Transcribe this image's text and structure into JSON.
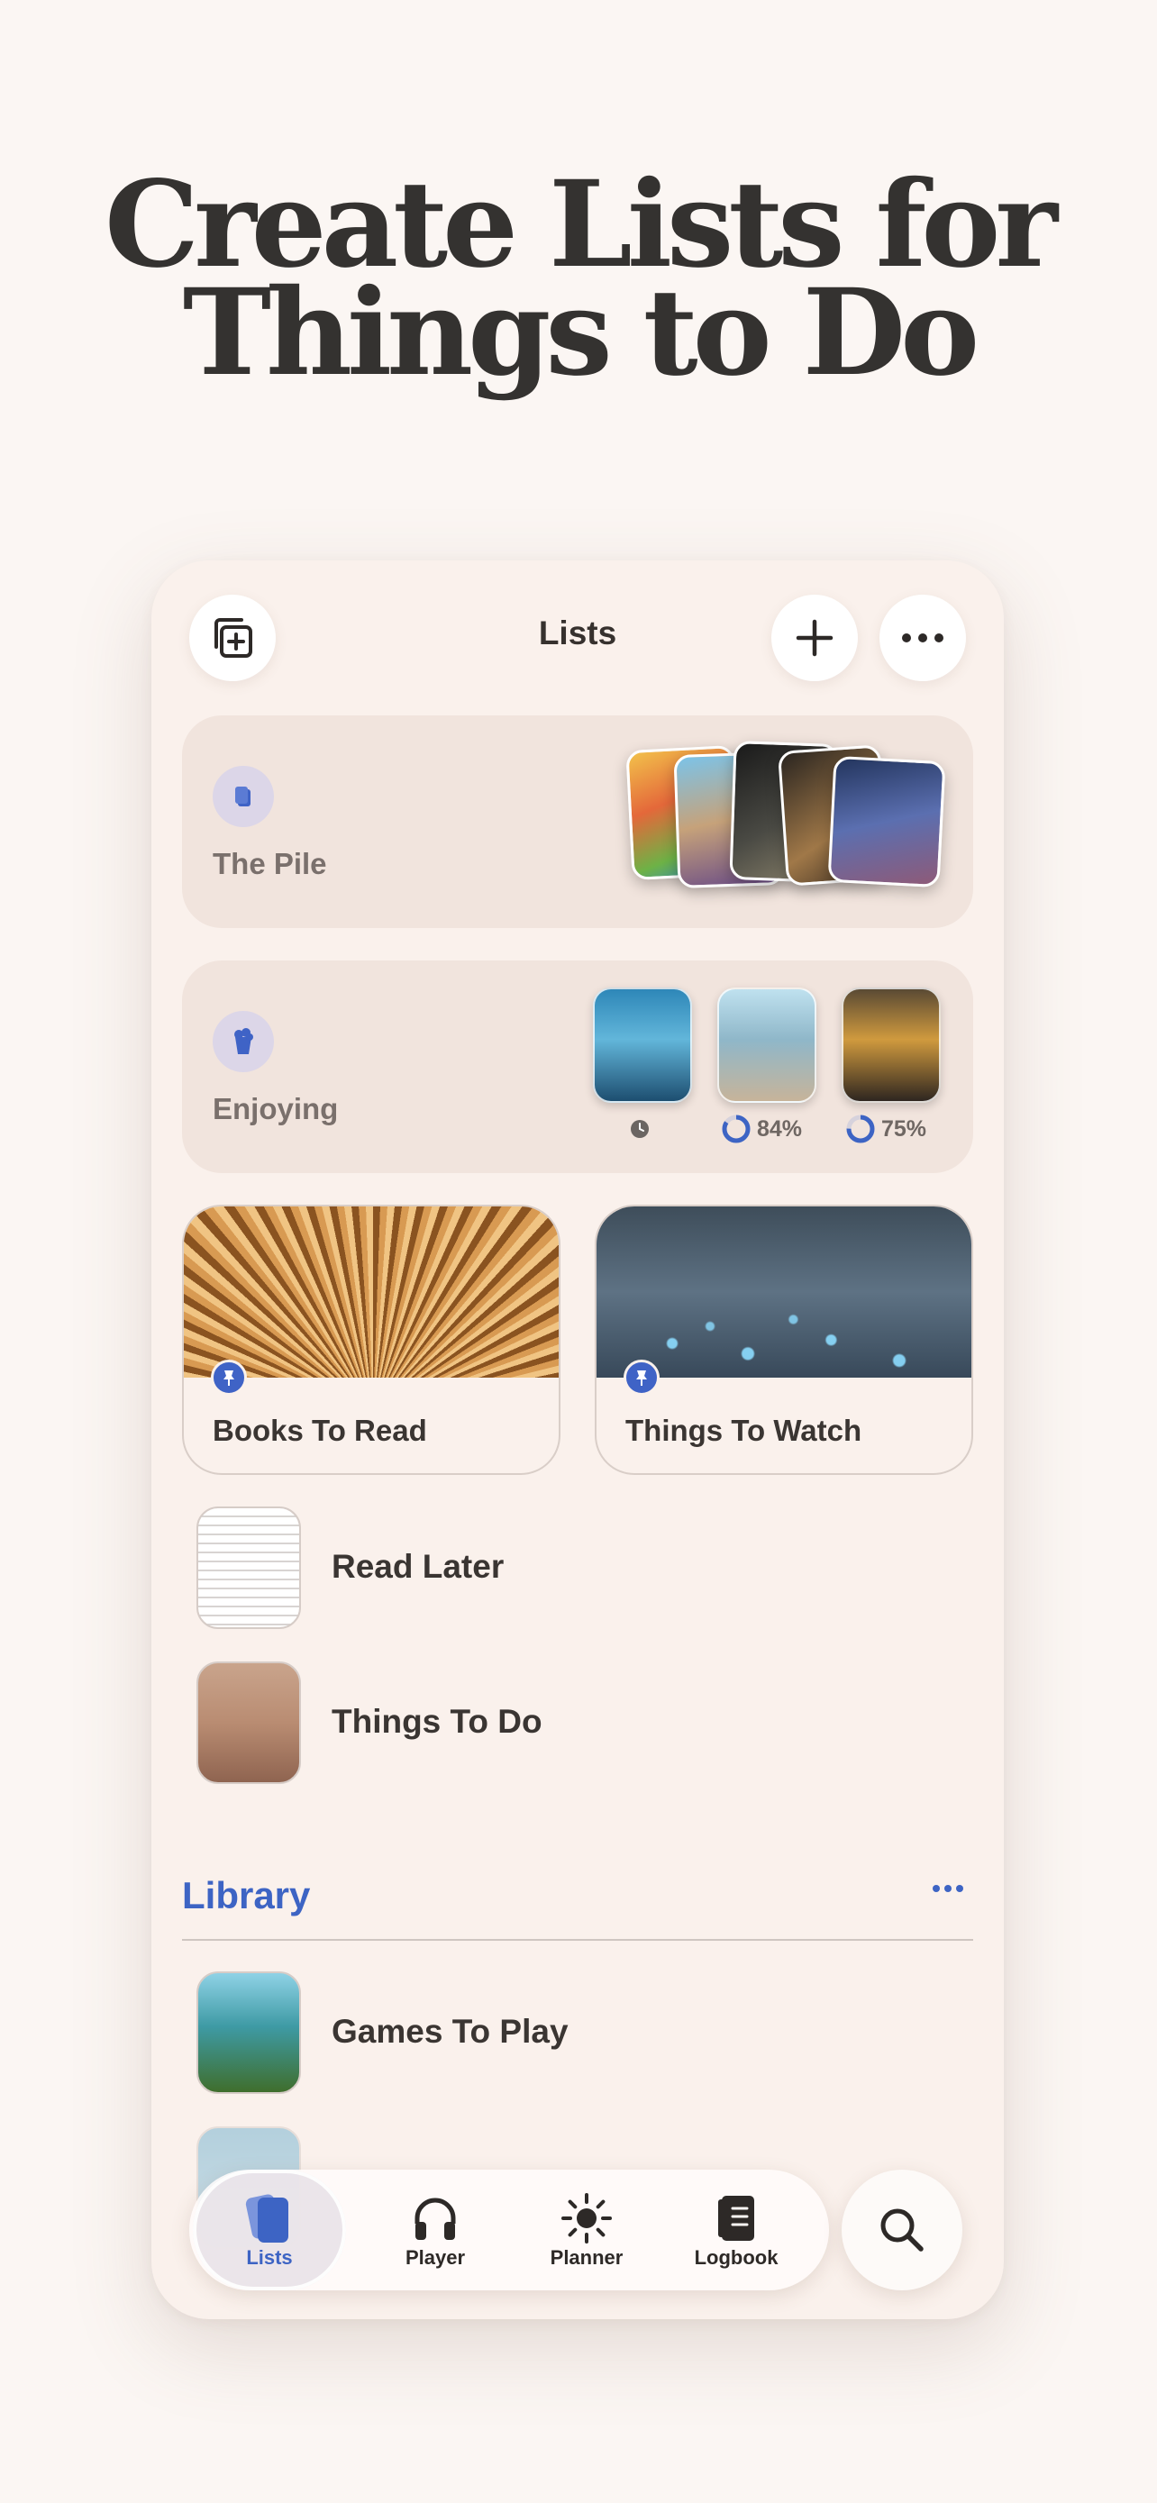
{
  "headline": {
    "line1": "Create Lists for",
    "line2": "Things to Do"
  },
  "nav": {
    "title": "Lists",
    "left_icon": "add-collection-icon",
    "add_icon": "plus-icon",
    "more_icon": "ellipsis-icon"
  },
  "pile": {
    "label": "The Pile",
    "icon": "cards-icon"
  },
  "enjoying": {
    "label": "Enjoying",
    "icon": "popcorn-icon",
    "items": [
      {
        "progress_label": "",
        "progress": 0
      },
      {
        "progress_label": "84%",
        "progress": 0.84
      },
      {
        "progress_label": "75%",
        "progress": 0.75
      }
    ]
  },
  "pinned": [
    {
      "label": "Books To Read",
      "icon": "pin-icon"
    },
    {
      "label": "Things To Watch",
      "icon": "pin-icon"
    }
  ],
  "lists": [
    {
      "label": "Read Later"
    },
    {
      "label": "Things To Do"
    }
  ],
  "library": {
    "title": "Library",
    "more_icon": "ellipsis-icon",
    "items": [
      {
        "label": "Games To Play"
      }
    ]
  },
  "tabs": [
    {
      "label": "Lists",
      "icon": "lists-icon",
      "active": true
    },
    {
      "label": "Player",
      "icon": "headphones-icon",
      "active": false
    },
    {
      "label": "Planner",
      "icon": "sun-icon",
      "active": false
    },
    {
      "label": "Logbook",
      "icon": "logbook-icon",
      "active": false
    }
  ],
  "search_icon": "search-icon",
  "colors": {
    "background": "#fbf6f3",
    "card": "#faf1ec",
    "accent": "#3d64c4",
    "headline": "#343230"
  }
}
